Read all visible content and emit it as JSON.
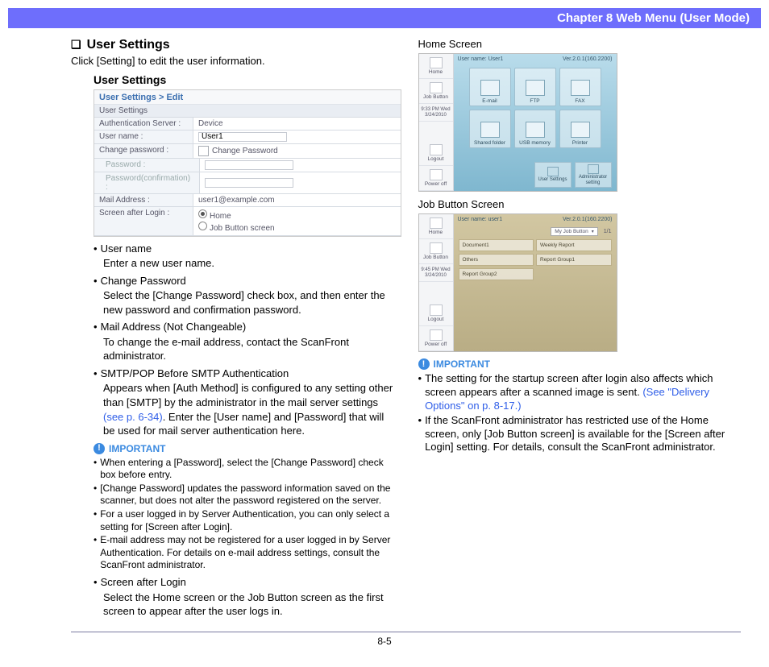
{
  "header": "Chapter 8   Web Menu (User Mode)",
  "page_number": "8-5",
  "left": {
    "section_title": "User Settings",
    "intro": "Click [Setting] to edit the user information.",
    "subhead": "User Settings",
    "bullets": {
      "username": {
        "h": "User name",
        "d": "Enter a new user name."
      },
      "changepw": {
        "h": "Change Password",
        "d": "Select the [Change Password] check box, and then enter the new password and confirmation password."
      },
      "mail": {
        "h": "Mail Address (Not Changeable)",
        "d": "To change the e-mail address, contact the ScanFront administrator."
      },
      "smtp": {
        "h": "SMTP/POP Before SMTP Authentication",
        "d_pre": "Appears when [Auth Method] is configured to any setting other than [SMTP] by the administrator in the mail server settings ",
        "d_link": "(see p. 6-34)",
        "d_post": ". Enter the [User name] and [Password] that will be used for mail server authentication here."
      },
      "screen": {
        "h": "Screen after Login",
        "d": "Select the Home screen or the Job Button screen as the first screen to appear after the user logs in."
      }
    },
    "important_label": "IMPORTANT",
    "important": {
      "i1": "When entering a [Password], select the [Change Password] check box before entry.",
      "i2": "[Change Password] updates the password information saved on the scanner, but does not alter the password registered on the server.",
      "i3": "For a user logged in by Server Authentication, you can only select a setting for [Screen after Login].",
      "i4": "E-mail address may not be registered for a user logged in by Server Authentication. For details on e-mail address settings, consult the ScanFront administrator."
    }
  },
  "right": {
    "home_head": "Home Screen",
    "job_head": "Job Button Screen",
    "important_label": "IMPORTANT",
    "imp1_pre": "The setting for the startup screen after login also affects which screen appears after a scanned image is sent. ",
    "imp1_link": "(See \"Delivery Options\" on p. 8-17.)",
    "imp2": "If the ScanFront administrator has restricted use of the Home screen, only [Job Button screen] is available for the [Screen after Login] setting. For details, consult the ScanFront administrator."
  },
  "userSettingsTable": {
    "title": "User Settings > Edit",
    "subbar": "User Settings",
    "rows": {
      "auth_server_k": "Authentication Server :",
      "auth_server_v": "Device",
      "username_k": "User name :",
      "username_v": "User1",
      "changepw_k": "Change password :",
      "changepw_label": "Change Password",
      "pw_k": "Password :",
      "pwc_k": "Password(confirmation) :",
      "mail_k": "Mail Address :",
      "mail_v": "user1@example.com",
      "screen_k": "Screen after Login :",
      "screen_home": "Home",
      "screen_job": "Job Button screen"
    }
  },
  "homeScreen": {
    "ver": "Ver.2.0.1(160.2200)",
    "uname": "User name: User1",
    "side": {
      "home": "Home",
      "job": "Job Button",
      "time": "9:33 PM  Wed 3/24/2010",
      "logout": "Logout",
      "power": "Power off"
    },
    "items": {
      "email": "E-mail",
      "ftp": "FTP",
      "fax": "FAX",
      "shared": "Shared folder",
      "usb": "USB memory",
      "printer": "Printer"
    },
    "bottom": {
      "usersettings": "User Settings",
      "adminset": "Administrator setting"
    }
  },
  "jobScreen": {
    "ver": "Ver.2.0.1(160.2200)",
    "uname": "User name: user1",
    "side": {
      "home": "Home",
      "job": "Job Button",
      "time": "9:45 PM  Wed 3/24/2010",
      "logout": "Logout",
      "power": "Power off"
    },
    "dd": "My Job Button",
    "pg": "1/1",
    "rows": {
      "r1a": "Document1",
      "r1b": "Weekly Report",
      "r2a": "Others",
      "r2b": "Report Group1",
      "r3a": "Report Group2"
    }
  }
}
